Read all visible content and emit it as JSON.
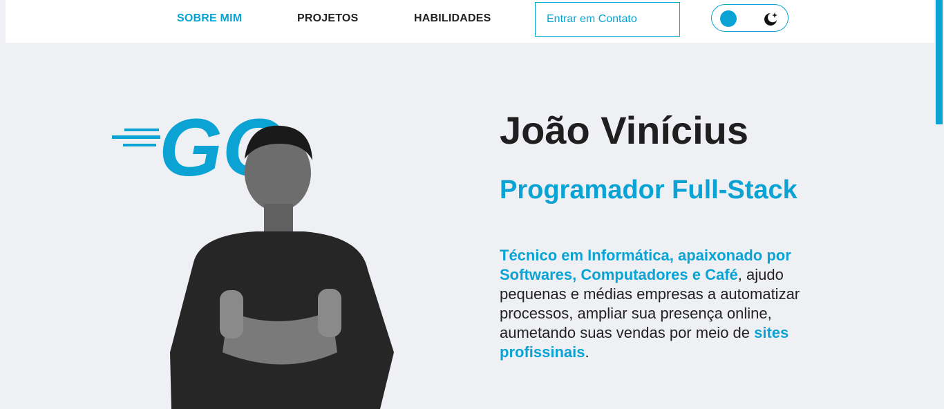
{
  "nav": {
    "links": [
      {
        "label": "SOBRE MIM"
      },
      {
        "label": "PROJETOS"
      },
      {
        "label": "HABILIDADES"
      }
    ],
    "contact_label": "Entrar em Contato"
  },
  "hero": {
    "logo_text": "GO",
    "name": "João Vinícius",
    "role": "Programador Full-Stack",
    "bio": {
      "p1": "Técnico em Informática, apaixonado por Softwares, Computadores e Café",
      "p2": ", ajudo pequenas e médias empresas a automatizar processos, ampliar sua presença online, aumetando suas vendas por meio de ",
      "p3": "sites profissinais",
      "p4": "."
    }
  },
  "colors": {
    "accent": "#0aa3d4",
    "background": "#eff0f4",
    "text": "#1f1f1f"
  }
}
